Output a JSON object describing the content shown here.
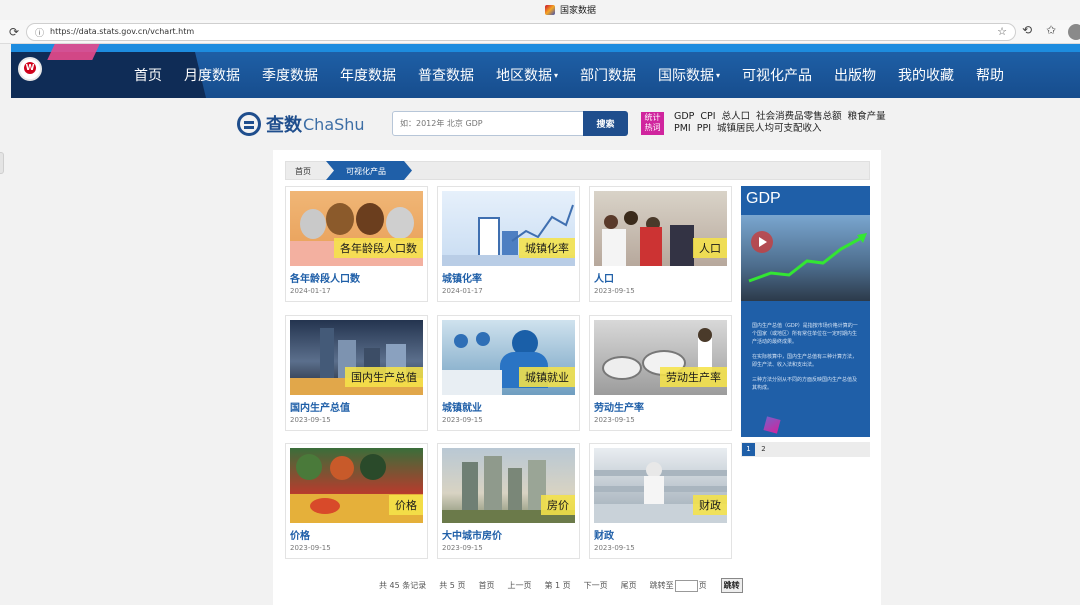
{
  "browser": {
    "tab_title": "国家数据",
    "url": "https://data.stats.gov.cn/vchart.htm"
  },
  "nav": {
    "items": [
      {
        "label": "首页",
        "dropdown": false
      },
      {
        "label": "月度数据",
        "dropdown": false
      },
      {
        "label": "季度数据",
        "dropdown": false
      },
      {
        "label": "年度数据",
        "dropdown": false
      },
      {
        "label": "普查数据",
        "dropdown": false
      },
      {
        "label": "地区数据",
        "dropdown": true
      },
      {
        "label": "部门数据",
        "dropdown": false
      },
      {
        "label": "国际数据",
        "dropdown": true
      },
      {
        "label": "可视化产品",
        "dropdown": false
      },
      {
        "label": "出版物",
        "dropdown": false
      },
      {
        "label": "我的收藏",
        "dropdown": false
      },
      {
        "label": "帮助",
        "dropdown": false
      }
    ]
  },
  "search": {
    "brand_cn": "查数",
    "brand_en": "ChaShu",
    "placeholder": "如：2012年 北京 GDP",
    "button_label": "搜索",
    "hot_badge": "统计热词",
    "hot_row1": [
      "GDP",
      "CPI",
      "总人口",
      "社会消费品零售总额",
      "粮食产量"
    ],
    "hot_row2": [
      "PMI",
      "PPI",
      "城镇居民人均可支配收入"
    ]
  },
  "breadcrumb": {
    "home": "首页",
    "current": "可视化产品"
  },
  "cards": [
    {
      "title": "各年龄段人口数",
      "date": "2024-01-17",
      "thumb_label": "各年龄段人口数"
    },
    {
      "title": "城镇化率",
      "date": "2024-01-17",
      "thumb_label": "城镇化率"
    },
    {
      "title": "人口",
      "date": "2023-09-15",
      "thumb_label": "人口"
    },
    {
      "title": "国内生产总值",
      "date": "2023-09-15",
      "thumb_label": "国内生产总值"
    },
    {
      "title": "城镇就业",
      "date": "2023-09-15",
      "thumb_label": "城镇就业"
    },
    {
      "title": "劳动生产率",
      "date": "2023-09-15",
      "thumb_label": "劳动生产率"
    },
    {
      "title": "价格",
      "date": "2023-09-15",
      "thumb_label": "价格"
    },
    {
      "title": "大中城市房价",
      "date": "2023-09-15",
      "thumb_label": "房价"
    },
    {
      "title": "财政",
      "date": "2023-09-15",
      "thumb_label": "财政"
    }
  ],
  "feature": {
    "title": "GDP",
    "text": [
      "国内生产总值（GDP）是指按市场价格计算的一个国家（或地区）所有常住单位在一定时期内生产活动的最终成果。",
      "在实际核算中，国内生产总值有三种计算方法，即生产法、收入法和支出法。",
      "三种方法分别从不同的方面反映国内生产总值及其构成。"
    ],
    "pages": [
      "1",
      "2"
    ]
  },
  "pagination": {
    "total_records": "共 45 条记录",
    "total_pages": "共 5 页",
    "first": "首页",
    "prev": "上一页",
    "current": "第 1 页",
    "next": "下一页",
    "last": "尾页",
    "jump_to": "跳转至",
    "page_unit": "页",
    "jump_button": "跳转"
  },
  "colors": {
    "nav_blue": "#1e5fa6",
    "accent_blue": "#1f5fa8",
    "hot_badge": "#d0259e",
    "thumb_label_bg": "#f5e249"
  }
}
